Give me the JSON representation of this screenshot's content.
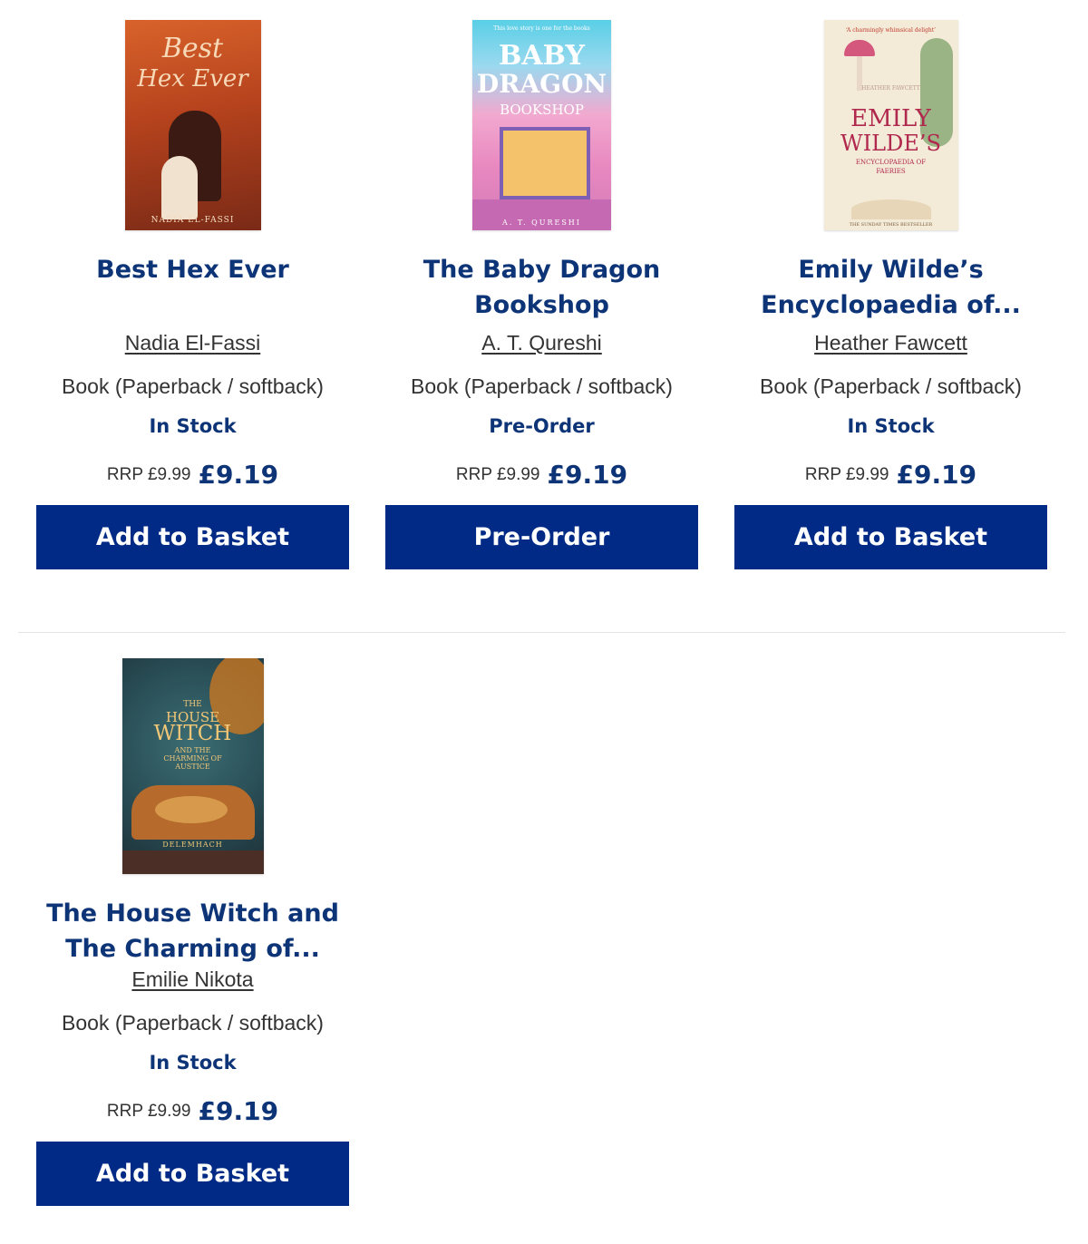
{
  "colors": {
    "brand_navy": "#0e3478",
    "button_bg": "#002a85",
    "button_text": "#ffffff"
  },
  "products": [
    {
      "title": "Best Hex Ever",
      "author": "Nadia El-Fassi",
      "format": "Book (Paperback / softback)",
      "availability": "In Stock",
      "rrp": "RRP £9.99",
      "price": "£9.19",
      "button": "Add to Basket",
      "cover": {
        "title_line1": "Best",
        "title_line2": "Hex Ever",
        "author": "NADIA EL-FASSI"
      }
    },
    {
      "title": "The Baby Dragon Bookshop",
      "author": "A. T. Qureshi",
      "format": "Book (Paperback / softback)",
      "availability": "Pre-Order",
      "rrp": "RRP £9.99",
      "price": "£9.19",
      "button": "Pre-Order",
      "cover": {
        "tagline": "This love story is one for the books",
        "title_line1": "BABY",
        "title_line2": "DRAGON",
        "title_line3": "BOOKSHOP",
        "author": "A. T. QURESHI"
      }
    },
    {
      "title": "Emily Wilde’s Encyclopaedia of...",
      "author": "Heather Fawcett",
      "format": "Book (Paperback / softback)",
      "availability": "In Stock",
      "rrp": "RRP £9.99",
      "price": "£9.19",
      "button": "Add to Basket",
      "cover": {
        "quote": "‘A charmingly whimsical delight’",
        "author": "HEATHER FAWCETT",
        "title_line1": "EMILY",
        "title_line2": "WILDE’S",
        "title_line3": "ENCYCLOPAEDIA OF FAERIES",
        "banner": "THE SUNDAY TIMES BESTSELLER"
      }
    },
    {
      "title": "The House Witch and The Charming of...",
      "author": "Emilie Nikota",
      "format": "Book (Paperback / softback)",
      "availability": "In Stock",
      "rrp": "RRP £9.99",
      "price": "£9.19",
      "button": "Add to Basket",
      "cover": {
        "title_line1": "THE",
        "title_line2": "HOUSE",
        "title_line3": "WITCH",
        "title_line4": "AND THE CHARMING OF AUSTICE",
        "author": "DELEMHACH"
      }
    }
  ]
}
